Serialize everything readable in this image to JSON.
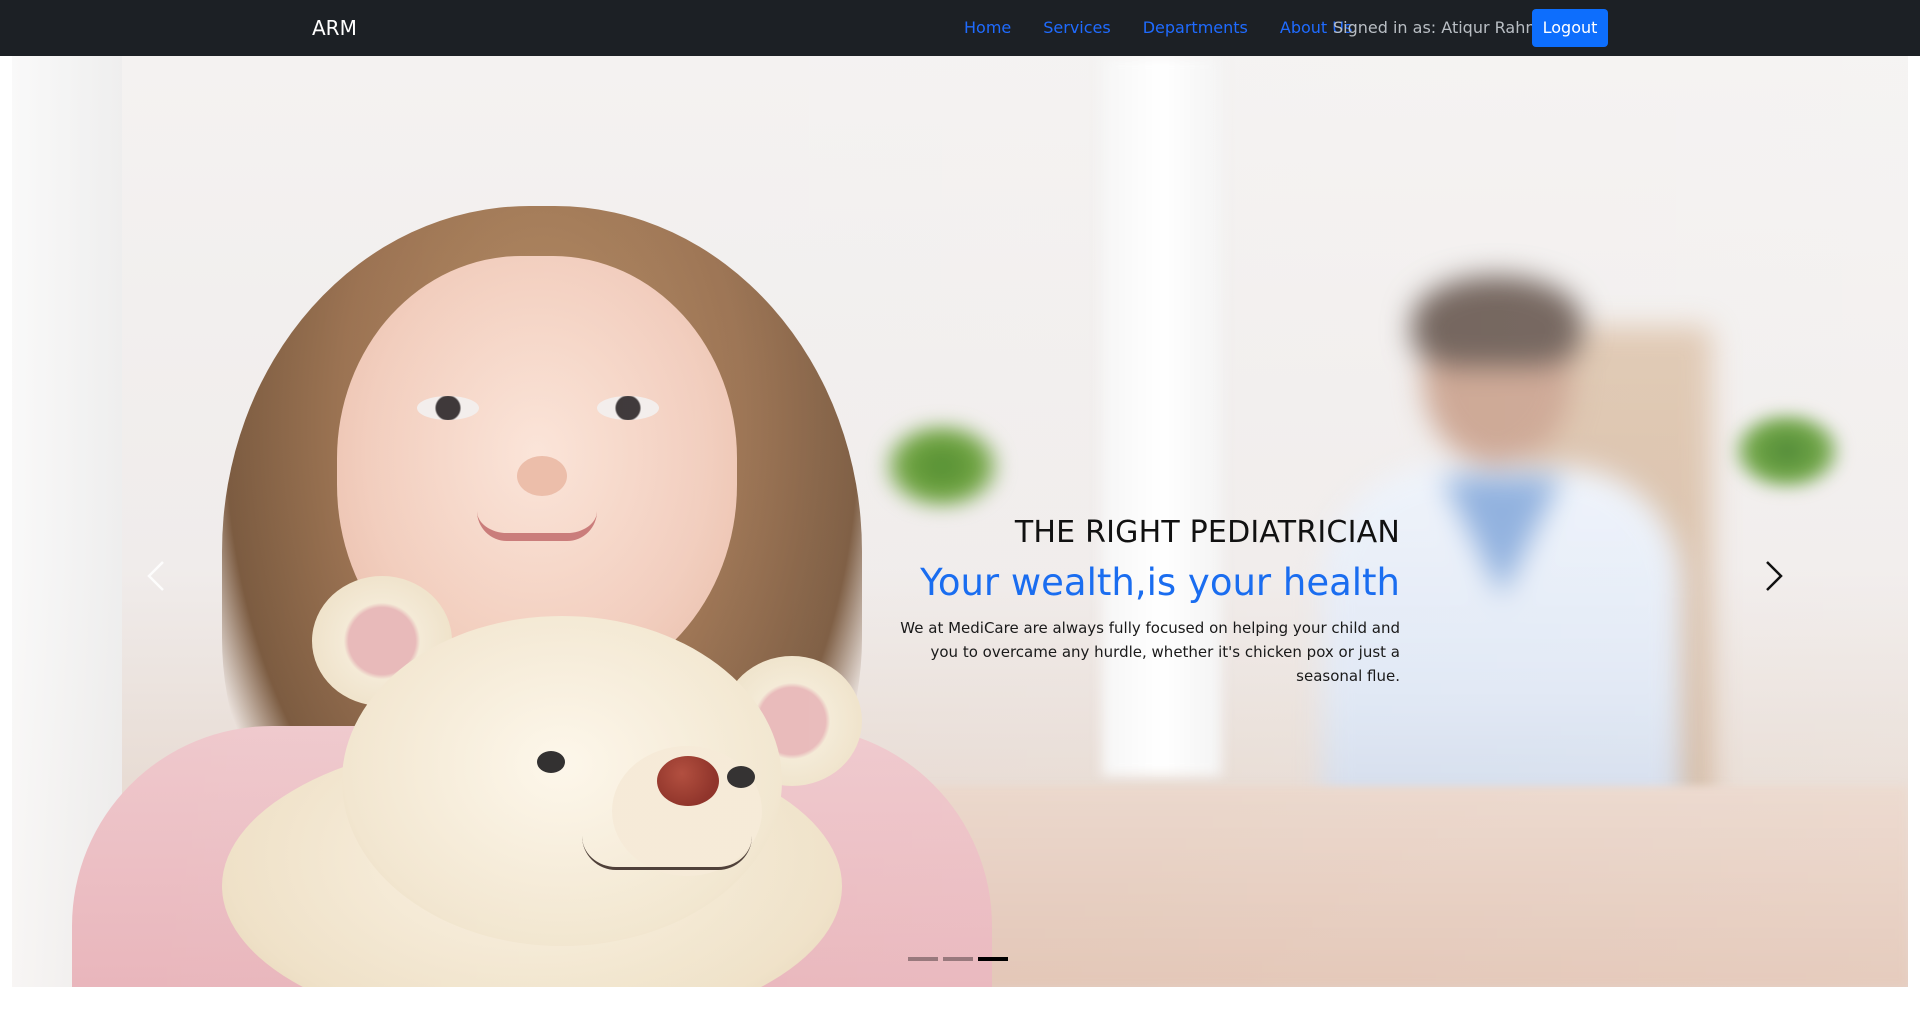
{
  "navbar": {
    "brand": "ARM",
    "links": [
      "Home",
      "Services",
      "Departments",
      "About Us"
    ],
    "signed_in_text": "Signed in as: Atiqur Rahman",
    "logout_label": "Logout"
  },
  "hero": {
    "overline": "THE RIGHT PEDIATRICIAN",
    "title": "Your wealth,is your health",
    "text": "We at MediCare are always fully focused on helping your child and you to overcame any hurdle, whether it's chicken pox or just a seasonal flue.",
    "prev_icon": "chevron-left-icon",
    "next_icon": "chevron-right-icon",
    "slide_count": 3,
    "active_slide": 3
  },
  "colors": {
    "navbar_bg": "#1c2025",
    "link": "#1f6bff",
    "button": "#0d6efd",
    "title_accent": "#1a6df0"
  }
}
